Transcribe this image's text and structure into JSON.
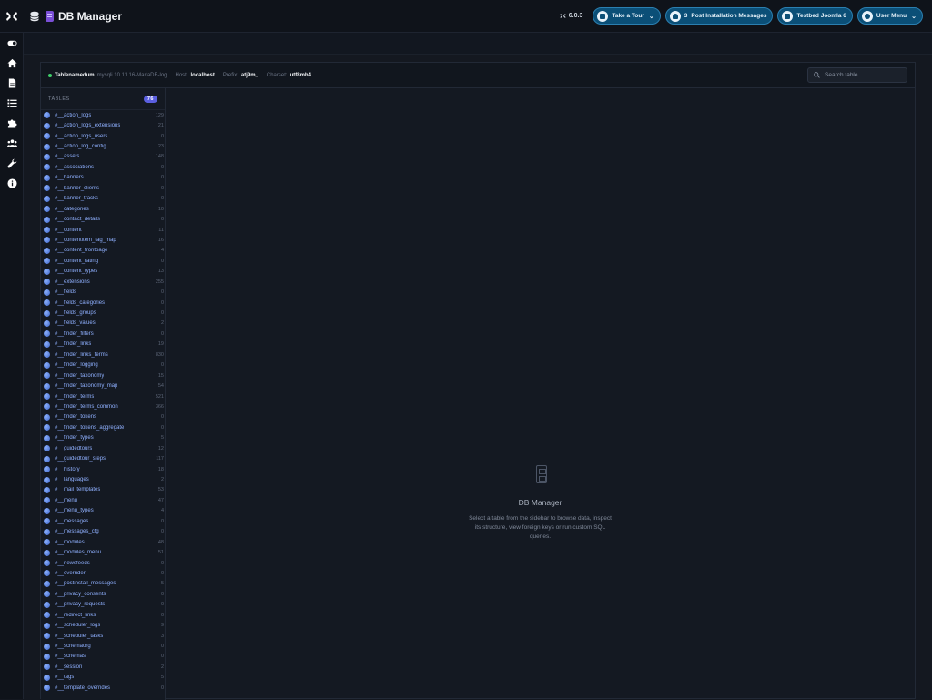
{
  "header": {
    "title": "DB Manager",
    "version": "6.0.3",
    "tour_label": "Take a Tour",
    "messages_count": "3",
    "messages_label": "Post Installation Messages",
    "site_label": "Testbed Joomla 6",
    "user_label": "User Menu"
  },
  "sidebar": {
    "icons": [
      "toggle-icon",
      "home-icon",
      "file-icon",
      "list-icon",
      "puzzle-icon",
      "users-icon",
      "wrench-icon",
      "info-icon"
    ]
  },
  "connection": {
    "database": "Tablenamedum",
    "server_version": "mysqli 10.11.16-MariaDB-log",
    "host_label": "Host:",
    "host": "localhost",
    "prefix_label": "Prefix:",
    "prefix": "atj9m_",
    "charset_label": "Charset:",
    "charset": "utf8mb4"
  },
  "search": {
    "placeholder": "Search table..."
  },
  "tables": {
    "heading": "TABLES",
    "count": "76",
    "items": [
      {
        "name": "#__action_logs",
        "rows": "129"
      },
      {
        "name": "#__action_logs_extensions",
        "rows": "21"
      },
      {
        "name": "#__action_logs_users",
        "rows": "0"
      },
      {
        "name": "#__action_log_config",
        "rows": "23"
      },
      {
        "name": "#__assets",
        "rows": "148"
      },
      {
        "name": "#__associations",
        "rows": "0"
      },
      {
        "name": "#__banners",
        "rows": "0"
      },
      {
        "name": "#__banner_clients",
        "rows": "0"
      },
      {
        "name": "#__banner_tracks",
        "rows": "0"
      },
      {
        "name": "#__categories",
        "rows": "10"
      },
      {
        "name": "#__contact_details",
        "rows": "0"
      },
      {
        "name": "#__content",
        "rows": "11"
      },
      {
        "name": "#__contentitem_tag_map",
        "rows": "16"
      },
      {
        "name": "#__content_frontpage",
        "rows": "4"
      },
      {
        "name": "#__content_rating",
        "rows": "0"
      },
      {
        "name": "#__content_types",
        "rows": "13"
      },
      {
        "name": "#__extensions",
        "rows": "255"
      },
      {
        "name": "#__fields",
        "rows": "0"
      },
      {
        "name": "#__fields_categories",
        "rows": "0"
      },
      {
        "name": "#__fields_groups",
        "rows": "0"
      },
      {
        "name": "#__fields_values",
        "rows": "2"
      },
      {
        "name": "#__finder_filters",
        "rows": "0"
      },
      {
        "name": "#__finder_links",
        "rows": "19"
      },
      {
        "name": "#__finder_links_terms",
        "rows": "830"
      },
      {
        "name": "#__finder_logging",
        "rows": "0"
      },
      {
        "name": "#__finder_taxonomy",
        "rows": "15"
      },
      {
        "name": "#__finder_taxonomy_map",
        "rows": "54"
      },
      {
        "name": "#__finder_terms",
        "rows": "521"
      },
      {
        "name": "#__finder_terms_common",
        "rows": "366"
      },
      {
        "name": "#__finder_tokens",
        "rows": "0"
      },
      {
        "name": "#__finder_tokens_aggregate",
        "rows": "0"
      },
      {
        "name": "#__finder_types",
        "rows": "5"
      },
      {
        "name": "#__guidedtours",
        "rows": "12"
      },
      {
        "name": "#__guidedtour_steps",
        "rows": "117"
      },
      {
        "name": "#__history",
        "rows": "18"
      },
      {
        "name": "#__languages",
        "rows": "2"
      },
      {
        "name": "#__mail_templates",
        "rows": "53"
      },
      {
        "name": "#__menu",
        "rows": "47"
      },
      {
        "name": "#__menu_types",
        "rows": "4"
      },
      {
        "name": "#__messages",
        "rows": "0"
      },
      {
        "name": "#__messages_cfg",
        "rows": "0"
      },
      {
        "name": "#__modules",
        "rows": "48"
      },
      {
        "name": "#__modules_menu",
        "rows": "51"
      },
      {
        "name": "#__newsfeeds",
        "rows": "0"
      },
      {
        "name": "#__overrider",
        "rows": "0"
      },
      {
        "name": "#__postinstall_messages",
        "rows": "5"
      },
      {
        "name": "#__privacy_consents",
        "rows": "0"
      },
      {
        "name": "#__privacy_requests",
        "rows": "0"
      },
      {
        "name": "#__redirect_links",
        "rows": "0"
      },
      {
        "name": "#__scheduler_logs",
        "rows": "9"
      },
      {
        "name": "#__scheduler_tasks",
        "rows": "3"
      },
      {
        "name": "#__schemaorg",
        "rows": "0"
      },
      {
        "name": "#__schemas",
        "rows": "0"
      },
      {
        "name": "#__session",
        "rows": "2"
      },
      {
        "name": "#__tags",
        "rows": "5"
      },
      {
        "name": "#__template_overrides",
        "rows": "0"
      }
    ]
  },
  "empty_state": {
    "title": "DB Manager",
    "description": "Select a table from the sidebar to browse data, inspect its structure, view foreign keys or run custom SQL queries."
  },
  "colors": {
    "accent": "#0b4f77",
    "badge": "#5b5fe0",
    "link": "#8fb0ff"
  }
}
